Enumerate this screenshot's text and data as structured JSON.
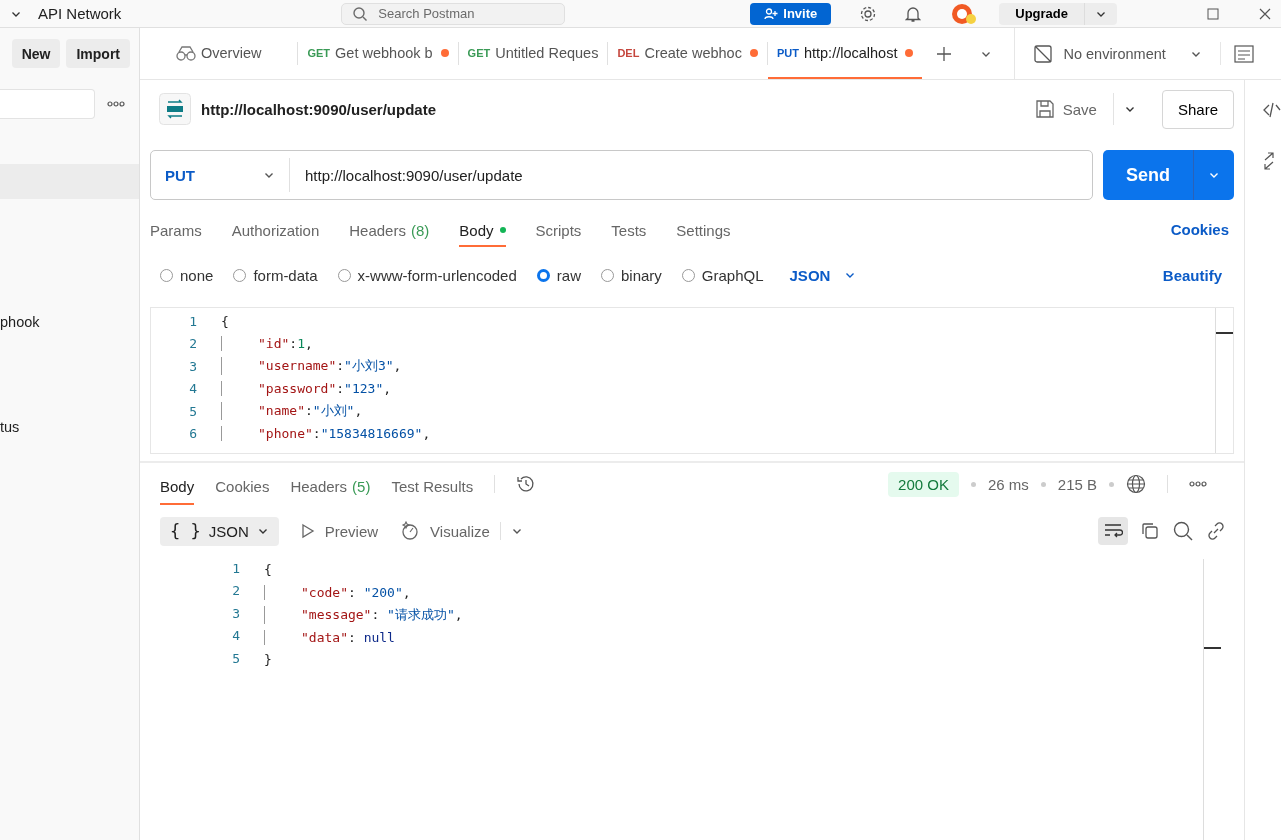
{
  "top_bar": {
    "workspace": "API Network",
    "search": {
      "placeholder": "Search Postman"
    },
    "invite": "Invite",
    "upgrade": "Upgrade"
  },
  "sidebar": {
    "buttons": [
      "New",
      "Import"
    ],
    "rows": [
      {
        "label": null,
        "selected": true
      },
      {
        "label": "phook",
        "selected": false
      },
      {
        "label": "tus",
        "selected": false
      }
    ]
  },
  "tabs": [
    {
      "kind": "overview",
      "label": "Overview",
      "selected": false,
      "unsaved": false
    },
    {
      "kind": "request",
      "method": "GET",
      "label": "Get webhook b",
      "selected": false,
      "unsaved": true
    },
    {
      "kind": "request",
      "method": "GET",
      "label": "Untitled Reques",
      "selected": false,
      "unsaved": false
    },
    {
      "kind": "request",
      "method": "DEL",
      "label": "Create webhoc",
      "selected": false,
      "unsaved": true
    },
    {
      "kind": "request",
      "method": "PUT",
      "label": "http://localhost",
      "selected": true,
      "unsaved": true
    }
  ],
  "environment": "No environment",
  "request": {
    "title": "http://localhost:9090/user/update",
    "save": "Save",
    "share": "Share",
    "method": "PUT",
    "url": "http://localhost:9090/user/update",
    "send": "Send",
    "tabs": [
      {
        "label": "Params",
        "selected": false
      },
      {
        "label": "Authorization",
        "selected": false
      },
      {
        "label": "Headers",
        "count": "(8)",
        "selected": false
      },
      {
        "label": "Body",
        "dot": true,
        "selected": true
      },
      {
        "label": "Scripts",
        "selected": false
      },
      {
        "label": "Tests",
        "selected": false
      },
      {
        "label": "Settings",
        "selected": false
      }
    ],
    "cookies": "Cookies",
    "body_types": [
      {
        "label": "none",
        "selected": false
      },
      {
        "label": "form-data",
        "selected": false
      },
      {
        "label": "x-www-form-urlencoded",
        "selected": false
      },
      {
        "label": "raw",
        "selected": true
      },
      {
        "label": "binary",
        "selected": false
      },
      {
        "label": "GraphQL",
        "selected": false
      }
    ],
    "format": "JSON",
    "beautify": "Beautify",
    "code": [
      {
        "number": "1",
        "indented": false,
        "tokens": [
          {
            "kind": "punct",
            "text": "{"
          }
        ]
      },
      {
        "number": "2",
        "indented": true,
        "tokens": [
          {
            "kind": "key",
            "text": "\"id\""
          },
          {
            "kind": "punct",
            "text": ":"
          },
          {
            "kind": "number",
            "text": "1"
          },
          {
            "kind": "punct",
            "text": ","
          }
        ]
      },
      {
        "number": "3",
        "indented": true,
        "tokens": [
          {
            "kind": "key",
            "text": "\"username\""
          },
          {
            "kind": "punct",
            "text": ":"
          },
          {
            "kind": "string",
            "text": "\"小刘3\""
          },
          {
            "kind": "punct",
            "text": ","
          }
        ]
      },
      {
        "number": "4",
        "indented": true,
        "tokens": [
          {
            "kind": "key",
            "text": "\"password\""
          },
          {
            "kind": "punct",
            "text": ":"
          },
          {
            "kind": "string",
            "text": "\"123\""
          },
          {
            "kind": "punct",
            "text": ","
          }
        ]
      },
      {
        "number": "5",
        "indented": true,
        "tokens": [
          {
            "kind": "key",
            "text": "\"name\""
          },
          {
            "kind": "punct",
            "text": ":"
          },
          {
            "kind": "string",
            "text": "\"小刘\""
          },
          {
            "kind": "punct",
            "text": ","
          }
        ]
      },
      {
        "number": "6",
        "indented": true,
        "tokens": [
          {
            "kind": "key",
            "text": "\"phone\""
          },
          {
            "kind": "punct",
            "text": ":"
          },
          {
            "kind": "string",
            "text": "\"15834816669\""
          },
          {
            "kind": "punct",
            "text": ","
          }
        ]
      }
    ]
  },
  "response": {
    "tabs": [
      {
        "label": "Body",
        "selected": true
      },
      {
        "label": "Cookies",
        "selected": false
      },
      {
        "label": "Headers",
        "count": "(5)",
        "selected": false
      },
      {
        "label": "Test Results",
        "selected": false
      }
    ],
    "status": "200 OK",
    "time": "26 ms",
    "size": "215 B",
    "format_icon": "{ }",
    "format": "JSON",
    "preview": "Preview",
    "visualize": "Visualize",
    "wrap_on": true,
    "code": [
      {
        "number": "1",
        "indented": false,
        "tokens": [
          {
            "kind": "punct",
            "text": "{"
          }
        ]
      },
      {
        "number": "2",
        "indented": true,
        "tokens": [
          {
            "kind": "key",
            "text": "\"code\""
          },
          {
            "kind": "punct",
            "text": ": "
          },
          {
            "kind": "string",
            "text": "\"200\""
          },
          {
            "kind": "punct",
            "text": ","
          }
        ]
      },
      {
        "number": "3",
        "indented": true,
        "tokens": [
          {
            "kind": "key",
            "text": "\"message\""
          },
          {
            "kind": "punct",
            "text": ": "
          },
          {
            "kind": "string",
            "text": "\"请求成功\""
          },
          {
            "kind": "punct",
            "text": ","
          }
        ]
      },
      {
        "number": "4",
        "indented": true,
        "tokens": [
          {
            "kind": "key",
            "text": "\"data\""
          },
          {
            "kind": "punct",
            "text": ": "
          },
          {
            "kind": "keyword",
            "text": "null"
          }
        ]
      },
      {
        "number": "5",
        "indented": false,
        "tokens": [
          {
            "kind": "punct",
            "text": "}"
          }
        ]
      }
    ]
  }
}
